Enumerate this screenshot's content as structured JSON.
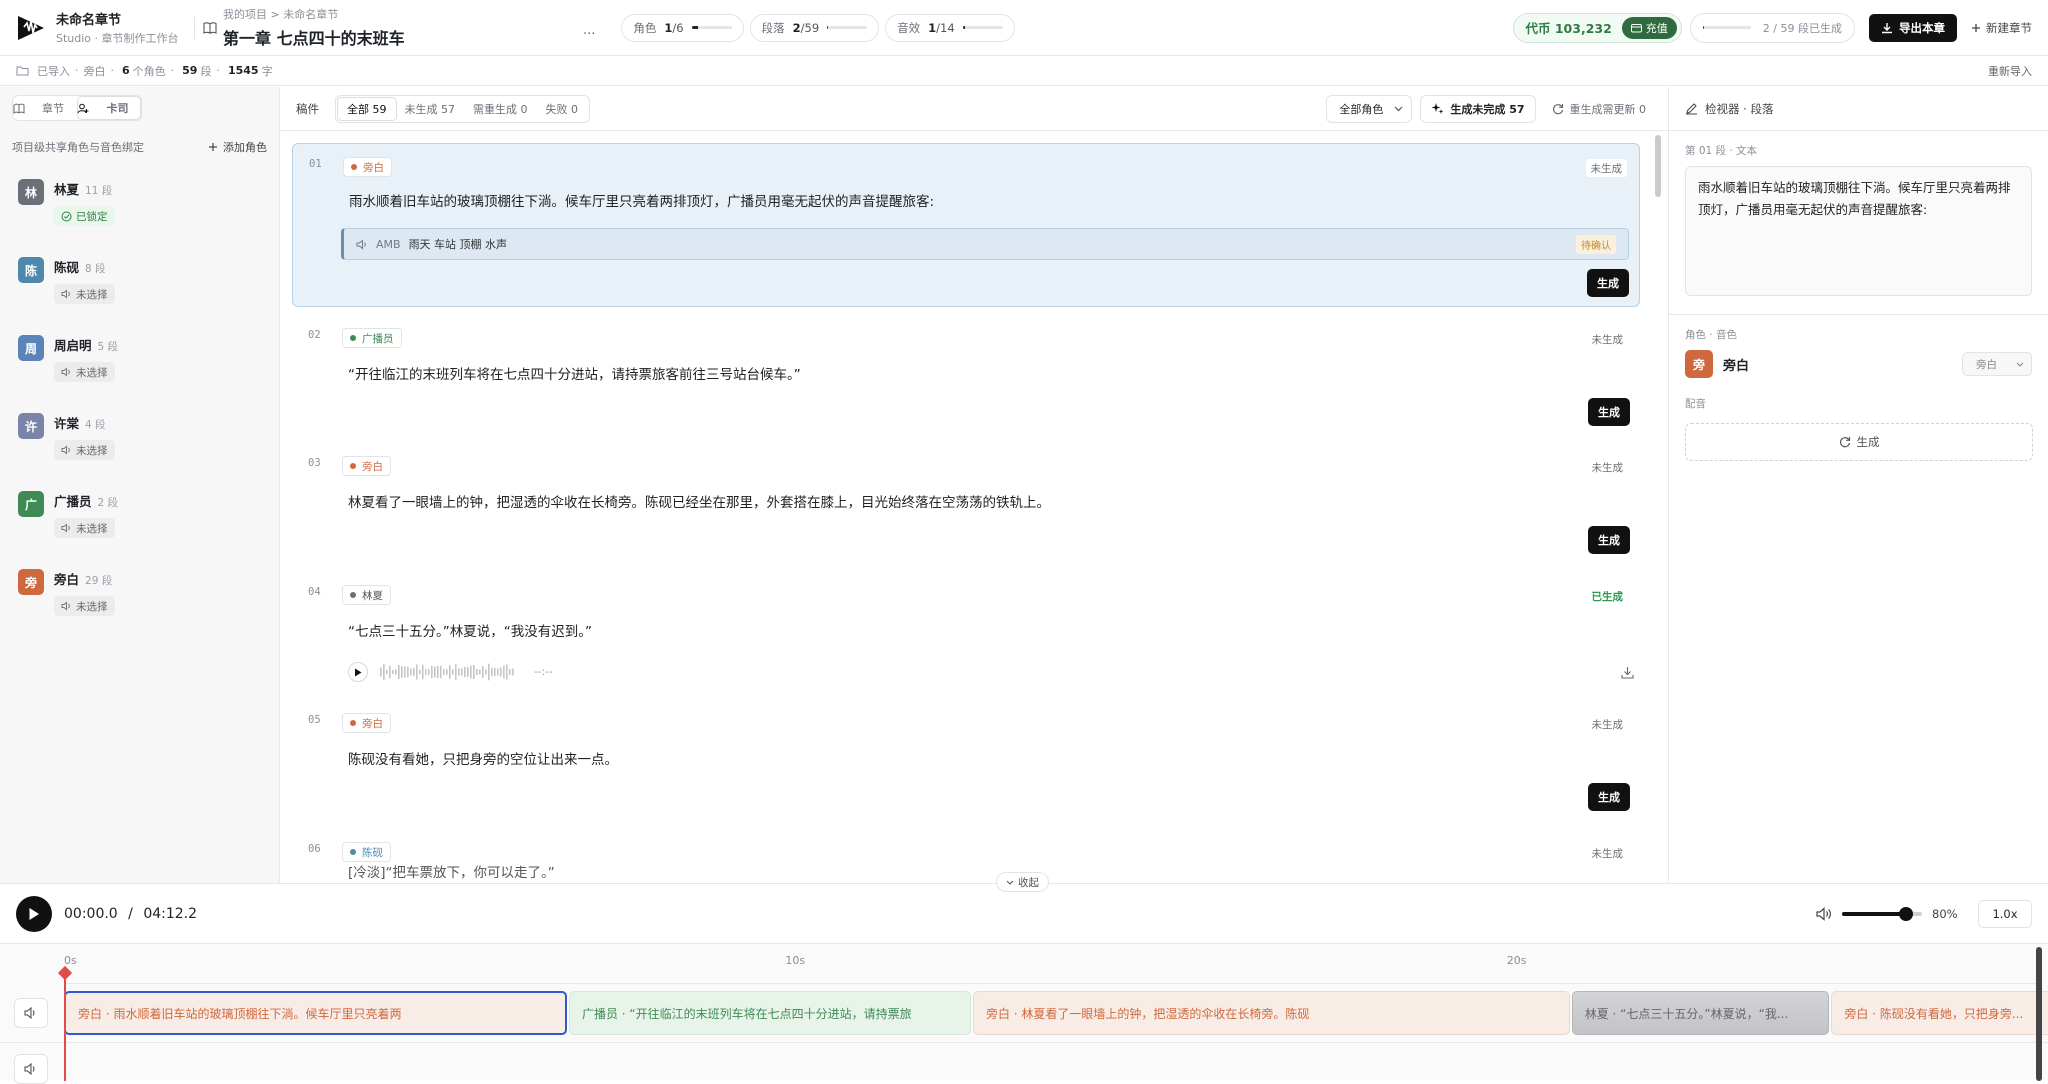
{
  "app": {
    "name": "未命名章节",
    "subtitle": "Studio · 章节制作工作台"
  },
  "header": {
    "breadcrumb": "我的项目 > 未命名章节",
    "chapter_title": "第一章 七点四十的末班车",
    "more_label": "···",
    "stats": [
      {
        "label": "角色",
        "value": "1",
        "total": "/6",
        "fraction": 0.17
      },
      {
        "label": "段落",
        "value": "2",
        "total": "/59",
        "fraction": 0.03
      },
      {
        "label": "音效",
        "value": "1",
        "total": "/14",
        "fraction": 0.07
      }
    ],
    "coins": "代币 103,232",
    "recharge_label": "充值",
    "progress_text": "2 / 59 段已生成",
    "progress_fraction": 0.034,
    "export_label": "导出本章",
    "new_label": "新建章节"
  },
  "status_bar": {
    "imported": "已导入",
    "narration": "旁白",
    "roles_count": "6",
    "roles_label": "个角色",
    "para_count": "59",
    "para_label": "段",
    "chars_count": "1545",
    "chars_label": "字",
    "reimport_label": "重新导入"
  },
  "sidebar": {
    "tabs": [
      {
        "label": "章节",
        "active": false
      },
      {
        "label": "卡司",
        "active": true
      }
    ],
    "section_title": "项目级共享角色与音色绑定",
    "add_role_label": "添加角色",
    "roles": [
      {
        "initial": "林",
        "name": "林夏",
        "count": "11 段",
        "voice": "已锁定",
        "locked": true,
        "color": "#6b6f78"
      },
      {
        "initial": "陈",
        "name": "陈砚",
        "count": "8 段",
        "voice": "未选择",
        "locked": false,
        "color": "#4f88ad"
      },
      {
        "initial": "周",
        "name": "周启明",
        "count": "5 段",
        "voice": "未选择",
        "locked": false,
        "color": "#5b84b8"
      },
      {
        "initial": "许",
        "name": "许棠",
        "count": "4 段",
        "voice": "未选择",
        "locked": false,
        "color": "#7a84a8"
      },
      {
        "initial": "广",
        "name": "广播员",
        "count": "2 段",
        "voice": "未选择",
        "locked": false,
        "color": "#3f8a55"
      },
      {
        "initial": "旁",
        "name": "旁白",
        "count": "29 段",
        "voice": "未选择",
        "locked": false,
        "color": "#d0683e"
      }
    ]
  },
  "main": {
    "manuscript_label": "稿件",
    "filters": [
      {
        "label": "全部 59",
        "active": true
      },
      {
        "label": "未生成 57",
        "active": false
      },
      {
        "label": "需重生成 0",
        "active": false
      },
      {
        "label": "失败 0",
        "active": false
      }
    ],
    "role_filter": "全部角色",
    "generate_pending_label": "生成未完成 57",
    "regen_updated_label": "重生成需更新 0",
    "generate_label": "生成",
    "collapse_label": "收起",
    "paragraphs": [
      {
        "num": "01",
        "role": "旁白",
        "dot": "#d0683e",
        "status": "未生成",
        "text": "雨水顺着旧车站的玻璃顶棚往下淌。候车厅里只亮着两排顶灯，广播员用毫无起伏的声音提醒旅客:",
        "amb_tag": "AMB",
        "amb_text": "雨天 车站 顶棚 水声",
        "amb_status": "待确认"
      },
      {
        "num": "02",
        "role": "广播员",
        "dot": "#3f8a55",
        "status": "未生成",
        "text": "“开往临江的末班列车将在七点四十分进站，请持票旅客前往三号站台候车。”"
      },
      {
        "num": "03",
        "role": "旁白",
        "dot": "#d0683e",
        "status": "未生成",
        "text": "林夏看了一眼墙上的钟，把湿透的伞收在长椅旁。陈砚已经坐在那里，外套搭在膝上，目光始终落在空荡荡的铁轨上。"
      },
      {
        "num": "04",
        "role": "林夏",
        "dot": "#6b6f78",
        "status": "已生成",
        "text": "“七点三十五分。”林夏说，“我没有迟到。”",
        "duration": "--:--"
      },
      {
        "num": "05",
        "role": "旁白",
        "dot": "#d0683e",
        "status": "未生成",
        "text": "陈砚没有看她，只把身旁的空位让出来一点。"
      },
      {
        "num": "06",
        "role": "陈砚",
        "dot": "#4f88ad",
        "status": "未生成",
        "text": "[冷淡]“把车票放下，你可以走了。”"
      }
    ]
  },
  "inspector": {
    "title": "检视器 · 段落",
    "text_label": "第 01 段 · 文本",
    "text_value": "雨水顺着旧车站的玻璃顶棚往下淌。候车厅里只亮着两排顶灯，广播员用毫无起伏的声音提醒旅客:",
    "role_section_label": "角色 · 音色",
    "role_initial": "旁",
    "role_name": "旁白",
    "role_select": "旁白",
    "role_color": "#d0683e",
    "dub_label": "配音",
    "generate_label": "生成"
  },
  "transport": {
    "current_time": "00:00.0",
    "separator": "/",
    "total_time": "04:12.2",
    "volume_pct": "80%",
    "volume_level": 0.8,
    "speed": "1.0x"
  },
  "timeline": {
    "ticks": [
      "0s",
      "10s",
      "20s"
    ],
    "tick_seconds": [
      0,
      10,
      20
    ],
    "clips": [
      {
        "label": "旁白 · 雨水顺着旧车站的玻璃顶棚往下淌。候车厅里只亮着两",
        "kind": "narr",
        "start": 0,
        "end": 7.0,
        "selected": true
      },
      {
        "label": "广播员 · “开往临江的末班列车将在七点四十分进站，请持票旅",
        "kind": "announcer",
        "start": 7.0,
        "end": 12.6,
        "selected": false
      },
      {
        "label": "旁白 · 林夏看了一眼墙上的钟，把湿透的伞收在长椅旁。陈砚",
        "kind": "narr",
        "start": 12.6,
        "end": 20.9,
        "selected": false
      },
      {
        "label": "林夏 · “七点三十五分。”林夏说，“我...",
        "kind": "lin",
        "start": 20.9,
        "end": 24.5,
        "selected": false
      },
      {
        "label": "旁白 · 陈砚没有看她，只把身旁...",
        "kind": "narr",
        "start": 24.5,
        "end": 27.8,
        "selected": false
      }
    ]
  }
}
